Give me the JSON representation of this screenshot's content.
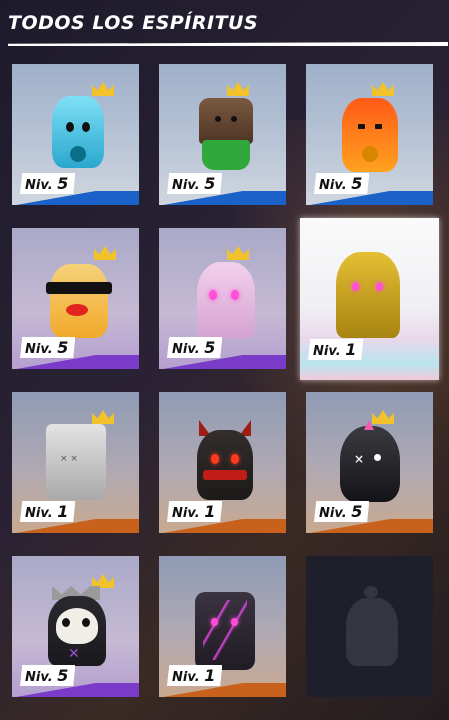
{
  "header": {
    "title": "TODOS LOS ESPÍRITUS"
  },
  "level_prefix": "Niv.",
  "spirits": [
    {
      "level": "5",
      "color": "#4cc8e8",
      "rarity_color": "#1b62c8"
    },
    {
      "level": "5",
      "color": "#6b4a35",
      "rarity_color": "#1b62c8"
    },
    {
      "level": "5",
      "color": "#ff8a1e",
      "rarity_color": "#1b62c8"
    },
    {
      "level": "5",
      "color": "#f7b733",
      "rarity_color": "#7a3cc8"
    },
    {
      "level": "5",
      "color": "#e7bde0",
      "rarity_color": "#7a3cc8"
    },
    {
      "level": "1",
      "color": "#c9a21c",
      "rarity_color": "#b9e4f0"
    },
    {
      "level": "1",
      "color": "#bfbfbf",
      "rarity_color": "#c8611c"
    },
    {
      "level": "1",
      "color": "#2d2d2d",
      "rarity_color": "#c8611c"
    },
    {
      "level": "5",
      "color": "#222226",
      "rarity_color": "#c8611c"
    },
    {
      "level": "5",
      "color": "#2a2a2e",
      "rarity_color": "#7a3cc8"
    },
    {
      "level": "1",
      "color": "#2b2630",
      "rarity_color": "#c8611c"
    }
  ],
  "locked_slot": "locked-spirit-silhouette"
}
